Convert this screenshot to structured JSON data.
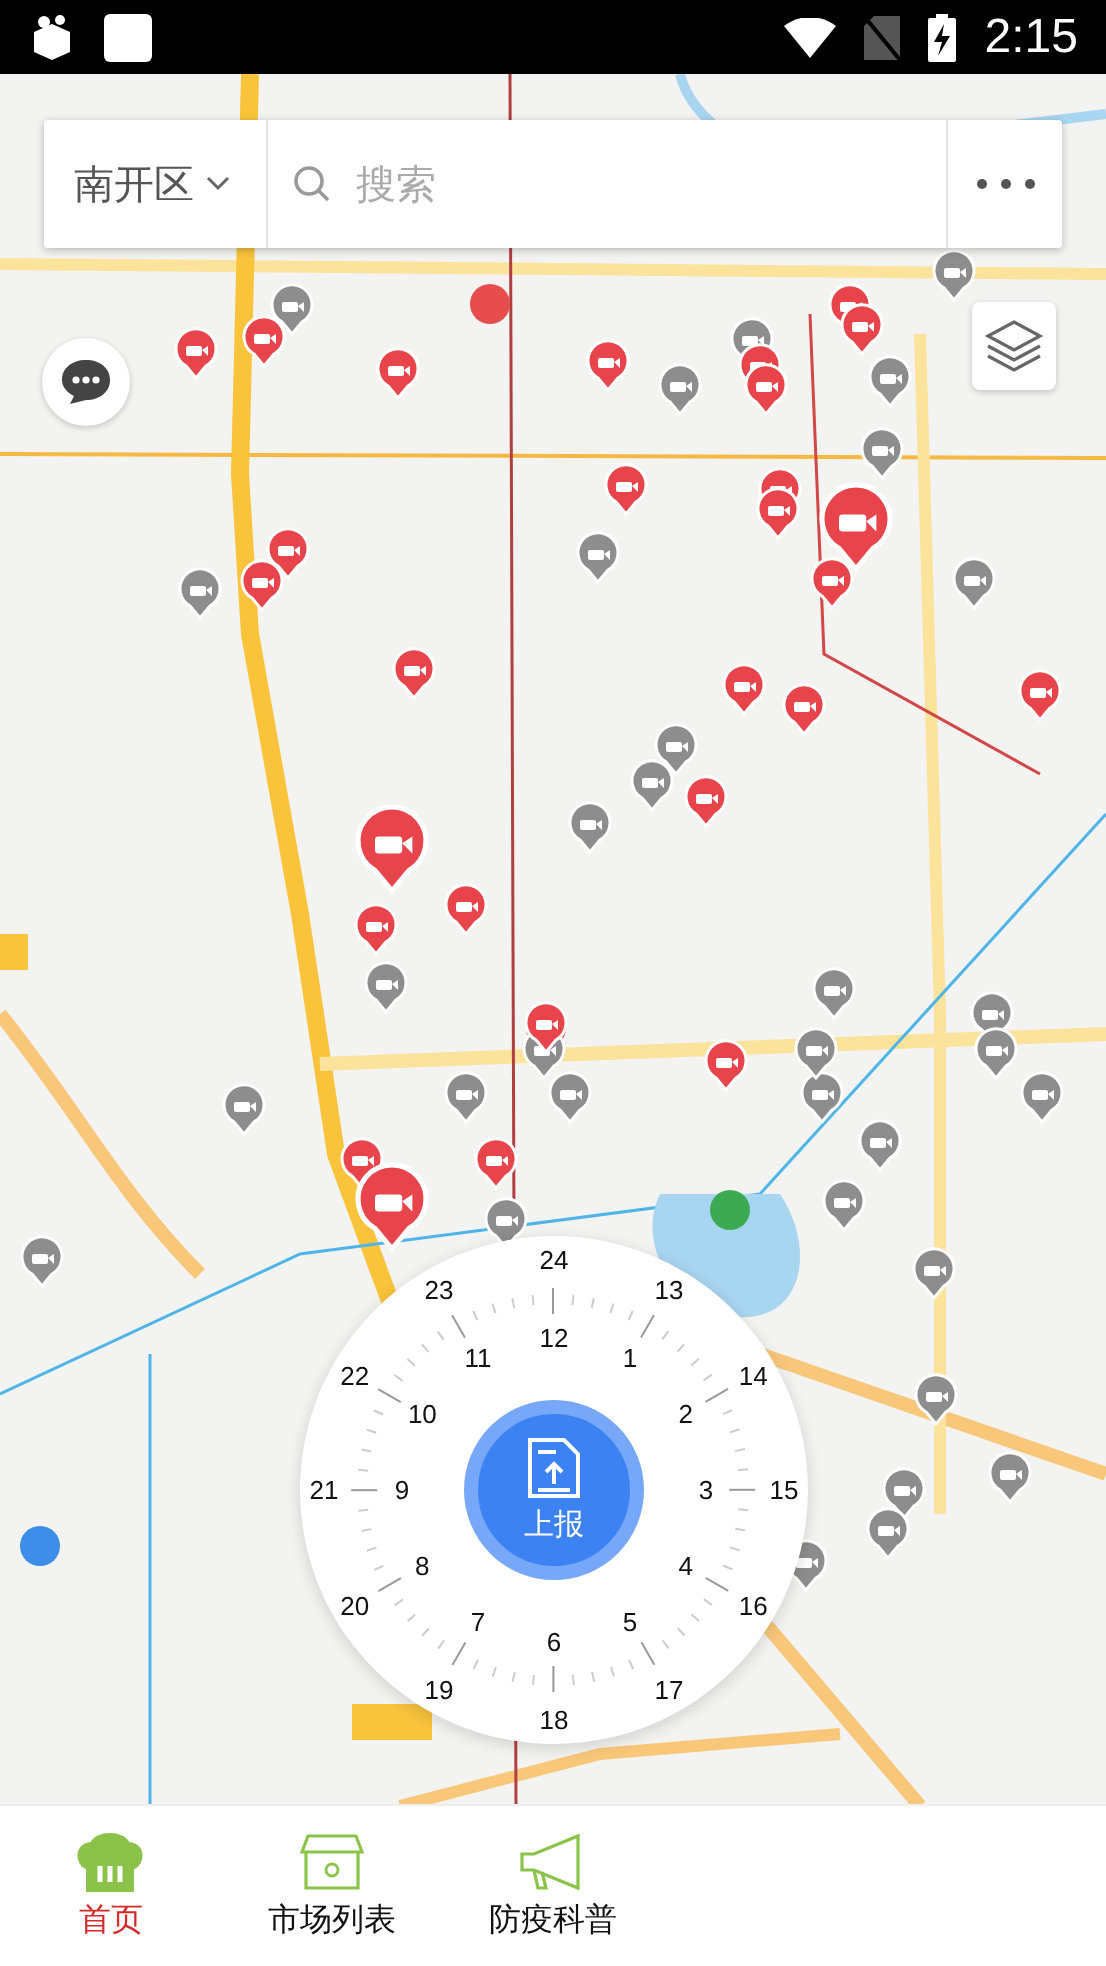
{
  "status_bar": {
    "time": "2:15"
  },
  "search_bar": {
    "district": "南开区",
    "placeholder": "搜索"
  },
  "report_dial": {
    "button_label": "上报",
    "inner_hours": [
      "12",
      "1",
      "2",
      "3",
      "4",
      "5",
      "6",
      "7",
      "8",
      "9",
      "10",
      "11"
    ],
    "outer_hours": [
      "24",
      "13",
      "14",
      "15",
      "16",
      "17",
      "18",
      "19",
      "20",
      "21",
      "22",
      "23"
    ]
  },
  "bottom_nav": [
    {
      "label": "首页",
      "selected": true
    },
    {
      "label": "市场列表",
      "selected": false
    },
    {
      "label": "防疫科普",
      "selected": false
    }
  ]
}
